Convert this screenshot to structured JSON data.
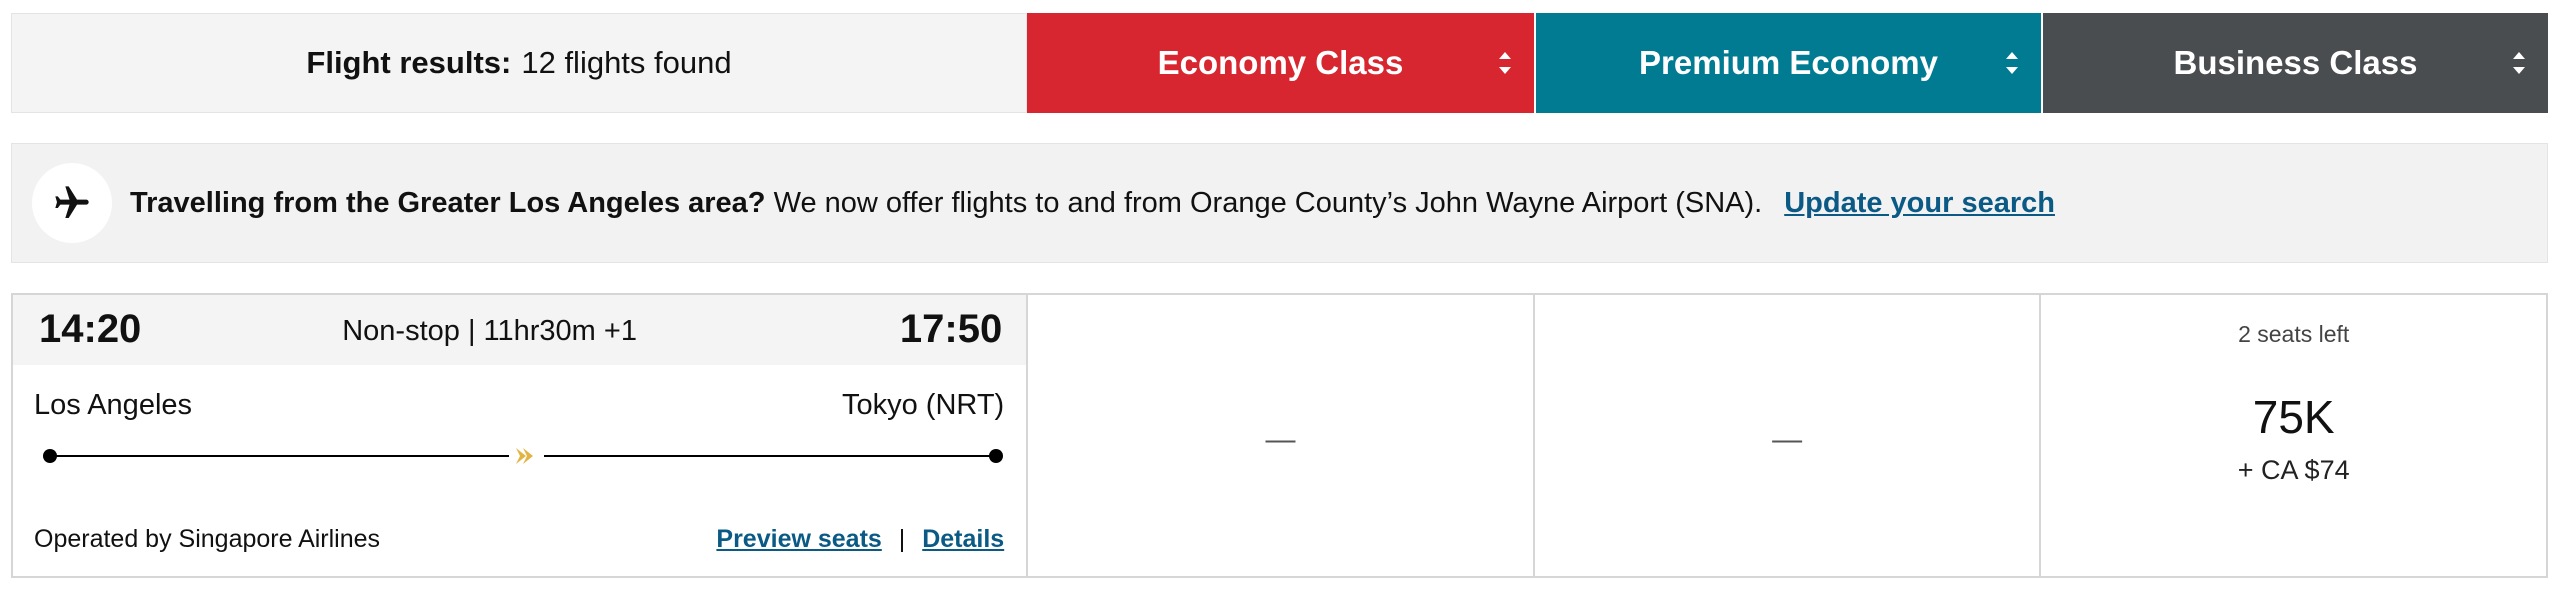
{
  "header": {
    "results_label": "Flight results:",
    "results_count": "12 flights found",
    "cabins": [
      {
        "label": "Economy Class",
        "color": "#d7262f"
      },
      {
        "label": "Premium Economy",
        "color": "#007b91"
      },
      {
        "label": "Business Class",
        "color": "#4a4d50"
      }
    ]
  },
  "banner": {
    "icon": "airplane-icon",
    "bold_text": "Travelling from the Greater Los Angeles area?",
    "text": "We now offer flights to and from Orange County’s John Wayne Airport (SNA).",
    "link": "Update your search"
  },
  "flight": {
    "departure_time": "14:20",
    "arrival_time": "17:50",
    "duration": "Non-stop | 11hr30m +1",
    "origin": "Los Angeles",
    "destination": "Tokyo (NRT)",
    "airline_logo_icon": "singapore-airlines-bird-icon",
    "operated_by": "Operated by Singapore Airlines",
    "preview_seats": "Preview seats",
    "separator": "|",
    "details": "Details",
    "fares": {
      "economy": "—",
      "premium_economy": "—",
      "business": {
        "seats_left": "2 seats left",
        "points": "75K",
        "cash": "+ CA $74"
      }
    }
  },
  "colors": {
    "link": "#0a5a85",
    "logo_gold": "#e2b443"
  }
}
